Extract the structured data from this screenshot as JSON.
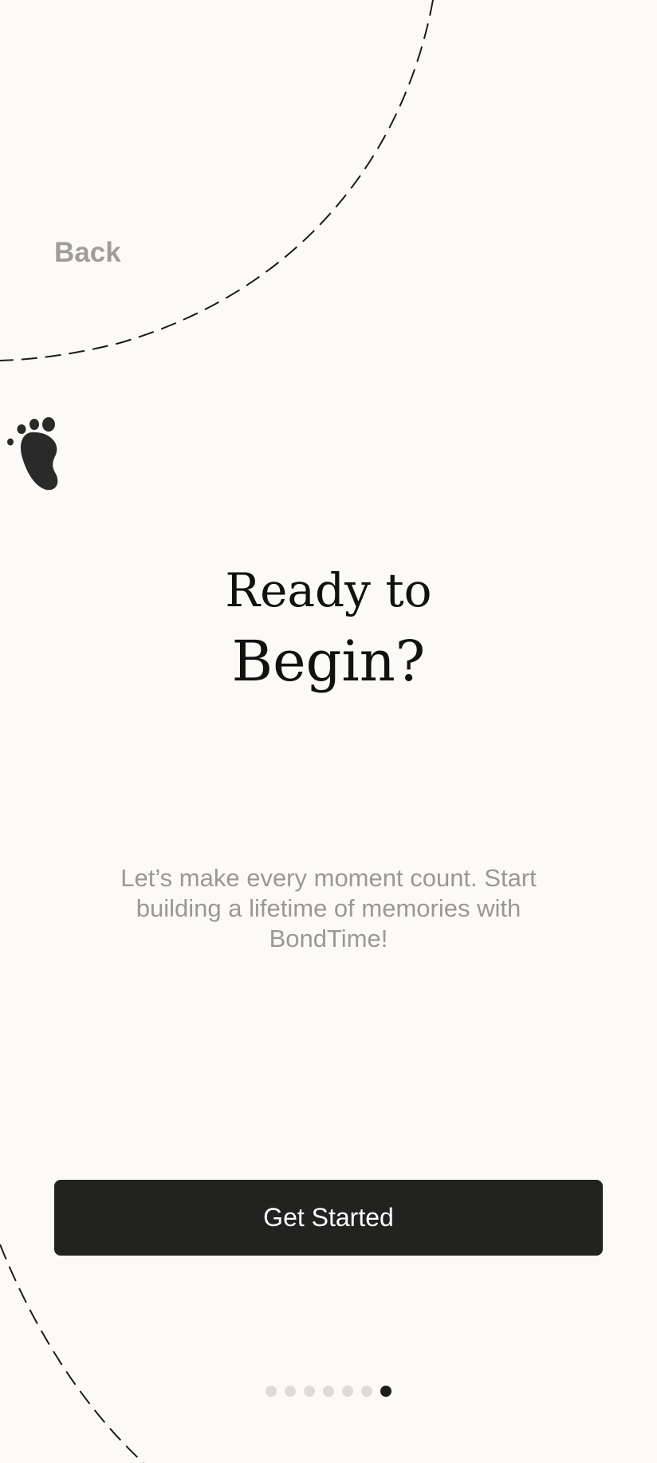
{
  "nav": {
    "back_label": "Back"
  },
  "hero": {
    "title_line1": "Ready to",
    "title_line2": "Begin?",
    "subtitle": "Let’s make every moment count. Start building a lifetime of memories with BondTime!",
    "icon": "baby-footprint-icon"
  },
  "cta": {
    "label": "Get Started"
  },
  "pager": {
    "total": 7,
    "active_index": 6
  },
  "colors": {
    "background": "#fcfaf6",
    "button": "#222221",
    "muted_text": "#9b9894",
    "title": "#111111",
    "dot_inactive": "#dedbd7",
    "dot_active": "#1e1e1e"
  }
}
